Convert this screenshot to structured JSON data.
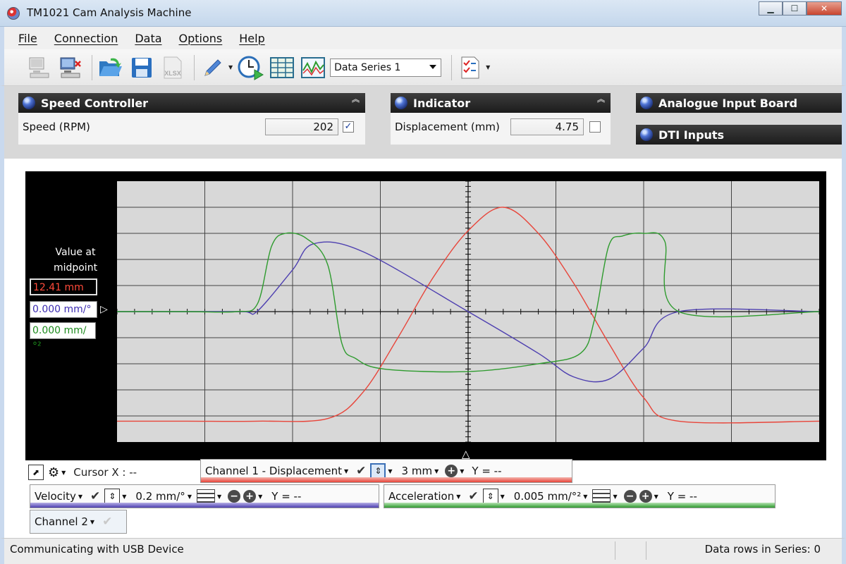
{
  "window": {
    "title": "TM1021 Cam Analysis Machine"
  },
  "menu": [
    "File",
    "Connection",
    "Data",
    "Options",
    "Help"
  ],
  "toolbar": {
    "series_select": "Data Series 1",
    "xlsx_label": "XLSX"
  },
  "speed_controller": {
    "title": "Speed Controller",
    "label": "Speed  (RPM)",
    "value": "202",
    "checked": "✓"
  },
  "indicator": {
    "title": "Indicator",
    "label": "Displacement  (mm)",
    "value": "4.75"
  },
  "analogue": {
    "title": "Analogue Input Board"
  },
  "dti": {
    "title": "DTI Inputs"
  },
  "readout": {
    "heading_line1": "Value at",
    "heading_line2": "midpoint",
    "displacement": "12.41 mm",
    "velocity": "0.000 mm/°",
    "acceleration": "0.000 mm/°²"
  },
  "controls": {
    "cursor_x": "Cursor X :  --",
    "channel1": {
      "name": "Channel 1 - Displacement",
      "scale": "3 mm",
      "y": "Y = --"
    },
    "velocity": {
      "name": "Velocity",
      "scale": "0.2 mm/°",
      "y": "Y = --"
    },
    "acceleration": {
      "name": "Acceleration",
      "scale": "0.005 mm/°²",
      "y": "Y = --"
    },
    "channel2": {
      "name": "Channel 2"
    }
  },
  "status": {
    "left": "Communicating with USB Device",
    "right": "Data rows in Series: 0"
  },
  "colors": {
    "displacement": "#e8453a",
    "velocity": "#4d3fb0",
    "acceleration": "#2e9b2e"
  },
  "chart_data": {
    "type": "line",
    "series": [
      {
        "name": "Displacement",
        "color": "#e8453a",
        "x": [
          0,
          0.1,
          0.2,
          0.3,
          0.35,
          0.4,
          0.45,
          0.5,
          0.55,
          0.6,
          0.65,
          0.7,
          0.75,
          0.8,
          1.0
        ],
        "y": [
          -4.2,
          -4.2,
          -4.2,
          -4.1,
          -3.1,
          -1.0,
          1.3,
          3.1,
          4.0,
          3.0,
          1.1,
          -1.2,
          -3.3,
          -4.2,
          -4.2
        ]
      },
      {
        "name": "Velocity",
        "color": "#4d3fb0",
        "x": [
          0,
          0.1,
          0.18,
          0.2,
          0.25,
          0.28,
          0.35,
          0.5,
          0.6,
          0.65,
          0.7,
          0.75,
          0.8,
          1.0
        ],
        "y": [
          0,
          0,
          0,
          0.02,
          1.6,
          2.6,
          2.3,
          0,
          -1.6,
          -2.5,
          -2.6,
          -1.4,
          0,
          0
        ]
      },
      {
        "name": "Acceleration",
        "color": "#2e9b2e",
        "x": [
          0,
          0.1,
          0.17,
          0.2,
          0.22,
          0.24,
          0.27,
          0.3,
          0.32,
          0.34,
          0.38,
          0.5,
          0.6,
          0.66,
          0.68,
          0.7,
          0.72,
          0.75,
          0.78,
          0.8,
          1.0
        ],
        "y": [
          0,
          0,
          0,
          0.3,
          2.5,
          3.0,
          2.8,
          1.8,
          -1.2,
          -1.8,
          -2.2,
          -2.3,
          -2.0,
          -1.6,
          -0.3,
          2.5,
          2.9,
          3.0,
          2.7,
          0,
          0
        ]
      }
    ],
    "xlim": [
      0,
      1
    ],
    "ylim": [
      -5,
      5
    ],
    "grid": true
  }
}
